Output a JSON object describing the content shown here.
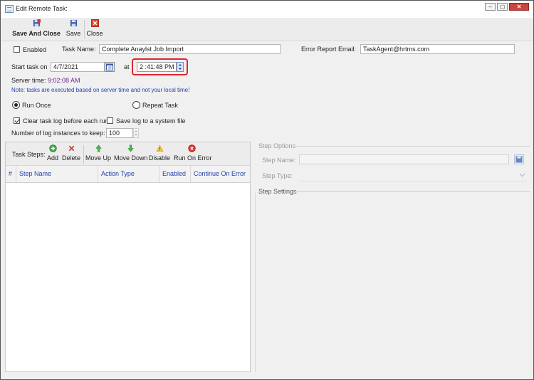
{
  "window": {
    "title": "Edit Remote Task:",
    "controls": {
      "minimize": "–",
      "restore": "▢",
      "close": "✕"
    }
  },
  "toolbar": {
    "save_and_close": "Save And Close",
    "save": "Save",
    "close": "Close"
  },
  "form": {
    "enabled_label": "Enabled",
    "enabled_checked": false,
    "task_name_label": "Task Name:",
    "task_name_value": "Complete Anaylst Job Import",
    "error_email_label": "Error Report Email:",
    "error_email_value": "TaskAgent@hrtms.com",
    "start_task_label": "Start task on",
    "start_date_value": "4/7/2021",
    "at_label": "at",
    "time_value": "2 :41:48 PM",
    "server_time_label": "Server time:",
    "server_time_value": "9:02:08 AM",
    "note": "Note: tasks are executed based on server time and not your local time!",
    "run_once_label": "Run Once",
    "repeat_task_label": "Repeat Task",
    "clear_log_label": "Clear task log before each run",
    "clear_log_checked": true,
    "save_log_label": "Save log to a system file",
    "save_log_checked": false,
    "log_instances_label": "Number of log instances to keep:",
    "log_instances_value": "100"
  },
  "steps": {
    "toolbar_label": "Task Steps:",
    "buttons": {
      "add": "Add",
      "delete": "Delete",
      "move_up": "Move Up",
      "move_down": "Move Down",
      "disable": "Disable",
      "run_on_error": "Run On Error"
    },
    "columns": [
      "#",
      "Step Name",
      "Action Type",
      "Enabled",
      "Continue On Error"
    ]
  },
  "step_options": {
    "section_title": "Step Options",
    "step_name_label": "Step Name:",
    "step_type_label": "Step Type:",
    "settings_title": "Step Settings"
  },
  "colors": {
    "accent_blue": "#1f3fb0",
    "server_time_purple": "#6b2a8a",
    "highlight_red": "#e0262e"
  }
}
